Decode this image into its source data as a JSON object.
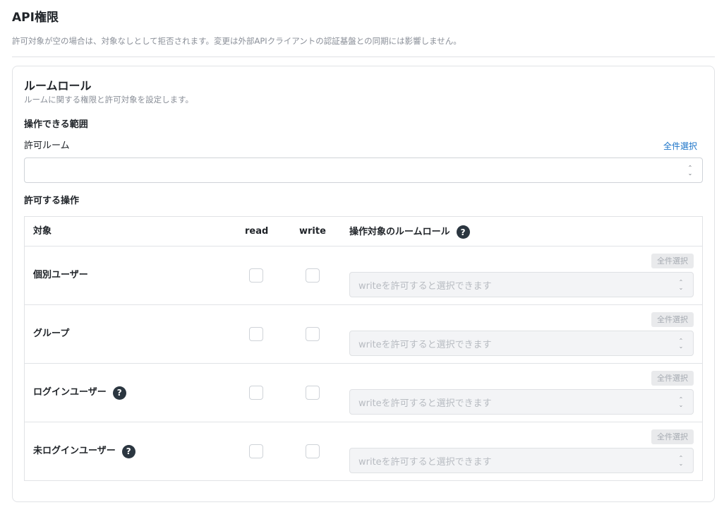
{
  "page": {
    "title": "API権限",
    "description": "許可対象が空の場合は、対象なしとして拒否されます。変更は外部APIクライアントの認証基盤との同期には影響しません。"
  },
  "card": {
    "title": "ルームロール",
    "description": "ルームに関する権限と許可対象を設定します。",
    "scope_label": "操作できる範囲",
    "room_field_label": "許可ルーム",
    "select_all_label": "全件選択",
    "room_select_value": "",
    "ops_label": "許可する操作"
  },
  "table": {
    "headers": {
      "target": "対象",
      "read": "read",
      "write": "write",
      "role": "操作対象のルームロール"
    },
    "rows": [
      {
        "label": "個別ユーザー",
        "select_all": "全件選択",
        "placeholder": "writeを許可すると選択できます"
      },
      {
        "label": "グループ",
        "select_all": "全件選択",
        "placeholder": "writeを許可すると選択できます"
      },
      {
        "label": "ログインユーザー",
        "select_all": "全件選択",
        "placeholder": "writeを許可すると選択できます"
      },
      {
        "label": "未ログインユーザー",
        "select_all": "全件選択",
        "placeholder": "writeを許可すると選択できます"
      }
    ]
  },
  "icons": {
    "help": "help-circle-icon",
    "select_chevron": "chevron-up-down-icon"
  },
  "colors": {
    "link": "#1a73c8",
    "help_icon_bg": "#2b3640",
    "muted_text": "#8a8f98"
  }
}
